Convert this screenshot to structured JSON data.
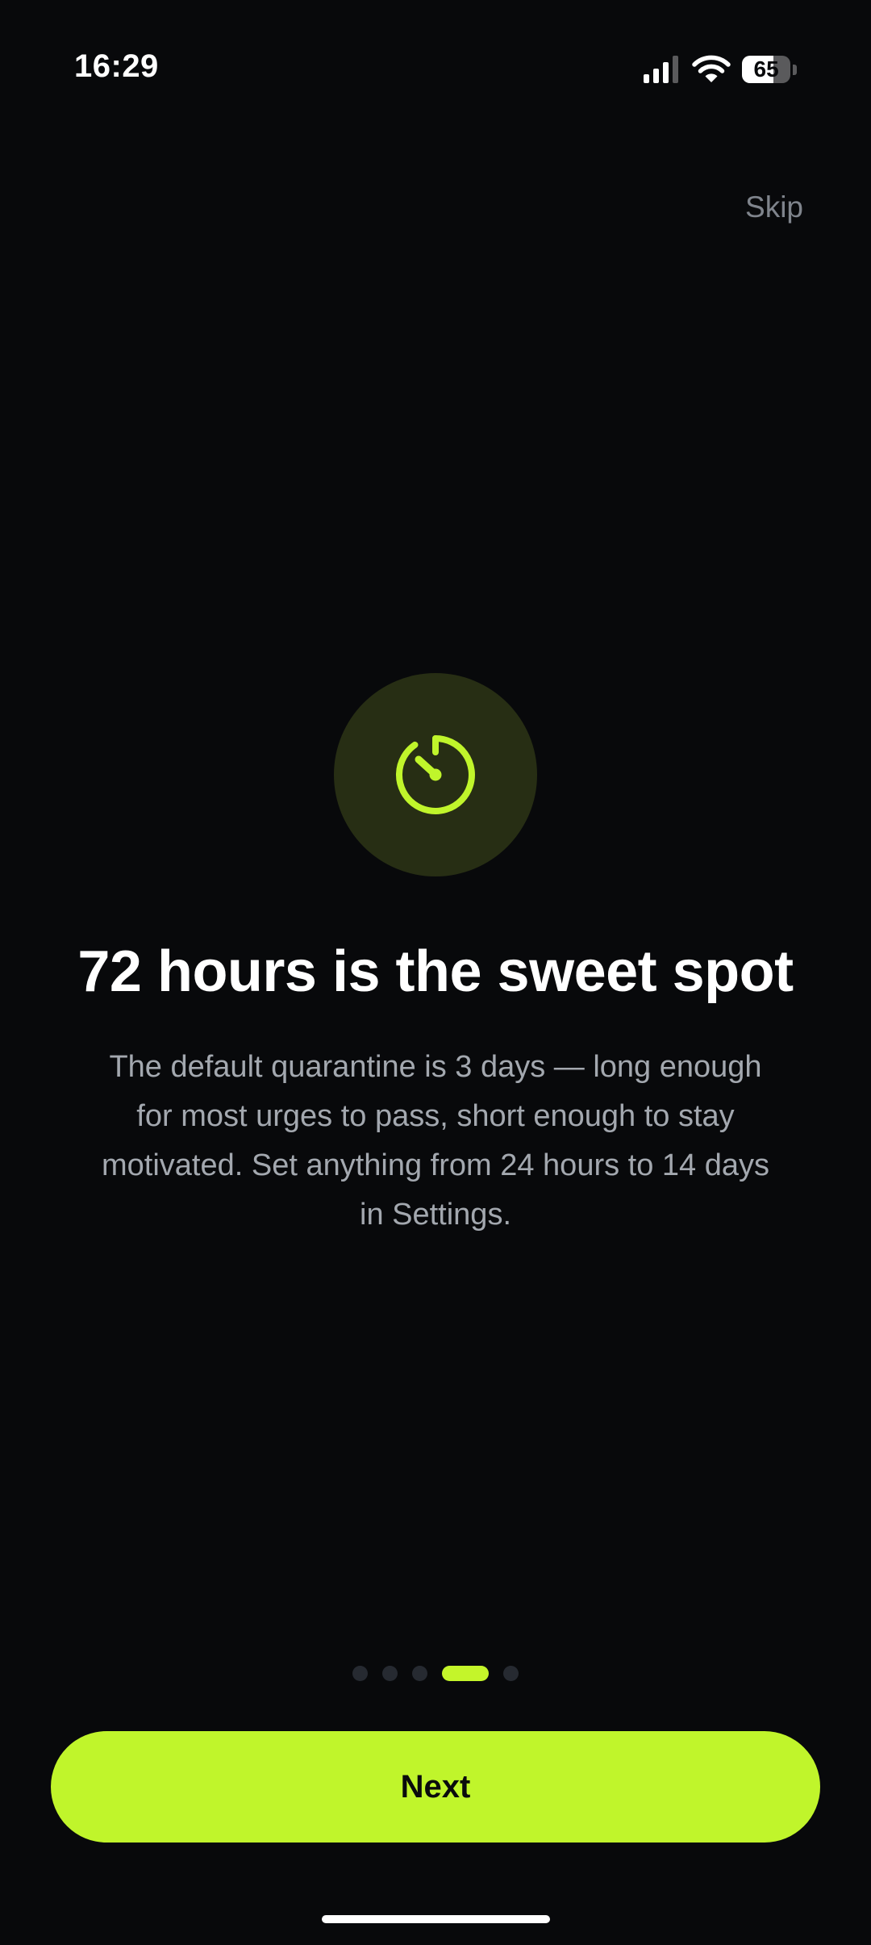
{
  "status_bar": {
    "time": "16:29",
    "battery_level": "65",
    "icons": [
      "signal-icon",
      "wifi-icon",
      "battery-icon"
    ]
  },
  "header": {
    "skip_label": "Skip"
  },
  "hero": {
    "icon": "timer-icon",
    "accent_color": "#c0f52b",
    "icon_background": "#272e14"
  },
  "content": {
    "title": "72 hours is the sweet spot",
    "description": "The default quarantine is 3 days — long enough for most urges to pass, short enough to stay motivated. Set anything from 24 hours to 14 days in Settings."
  },
  "pagination": {
    "total": 5,
    "active_index": 3
  },
  "footer": {
    "next_label": "Next"
  },
  "colors": {
    "background": "#08090b",
    "accent": "#c0f52b",
    "text_primary": "#ffffff",
    "text_secondary": "#a3a8af",
    "text_muted": "#7f848c"
  }
}
